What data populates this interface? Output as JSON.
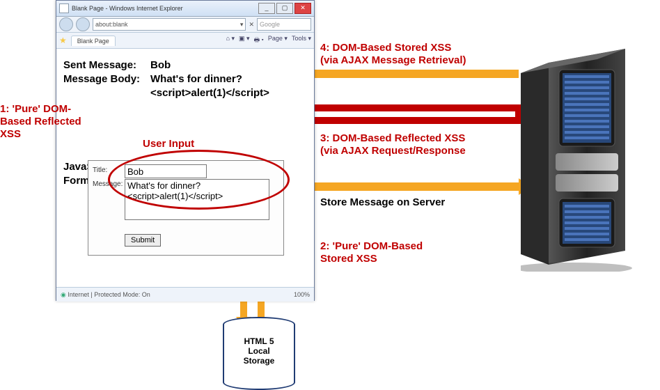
{
  "browser": {
    "title": "Blank Page - Windows Internet Explorer",
    "url": "about:blank",
    "search_hint": "Google",
    "tab_label": "Blank Page",
    "tool_page": "Page",
    "tool_tools": "Tools",
    "status": "Internet | Protected Mode: On",
    "zoom": "100%"
  },
  "display": {
    "sent_label": "Sent Message:",
    "body_label": "Message Body:",
    "sent_value": "Bob",
    "body_line1": "What's for dinner?",
    "body_line2": "<script>alert(1)</script>"
  },
  "form": {
    "section_label": "JavaScript Form",
    "title_label": "Title:",
    "message_label": "Message:",
    "title_value": "Bob",
    "message_value": "What's for dinner?\n<script>alert(1)</script>",
    "submit": "Submit"
  },
  "storage": {
    "label": "HTML 5\nLocal\nStorage"
  },
  "annotations": {
    "a1": "1: 'Pure' DOM-Based Reflected XSS",
    "a2": "2: 'Pure' DOM-Based Stored XSS",
    "a3": "3: DOM-Based Reflected XSS (via AJAX Request/Response",
    "a4": "4: DOM-Based Stored XSS (via AJAX Message Retrieval)",
    "user_input": "User Input",
    "store_msg": "Store Message on Server"
  }
}
